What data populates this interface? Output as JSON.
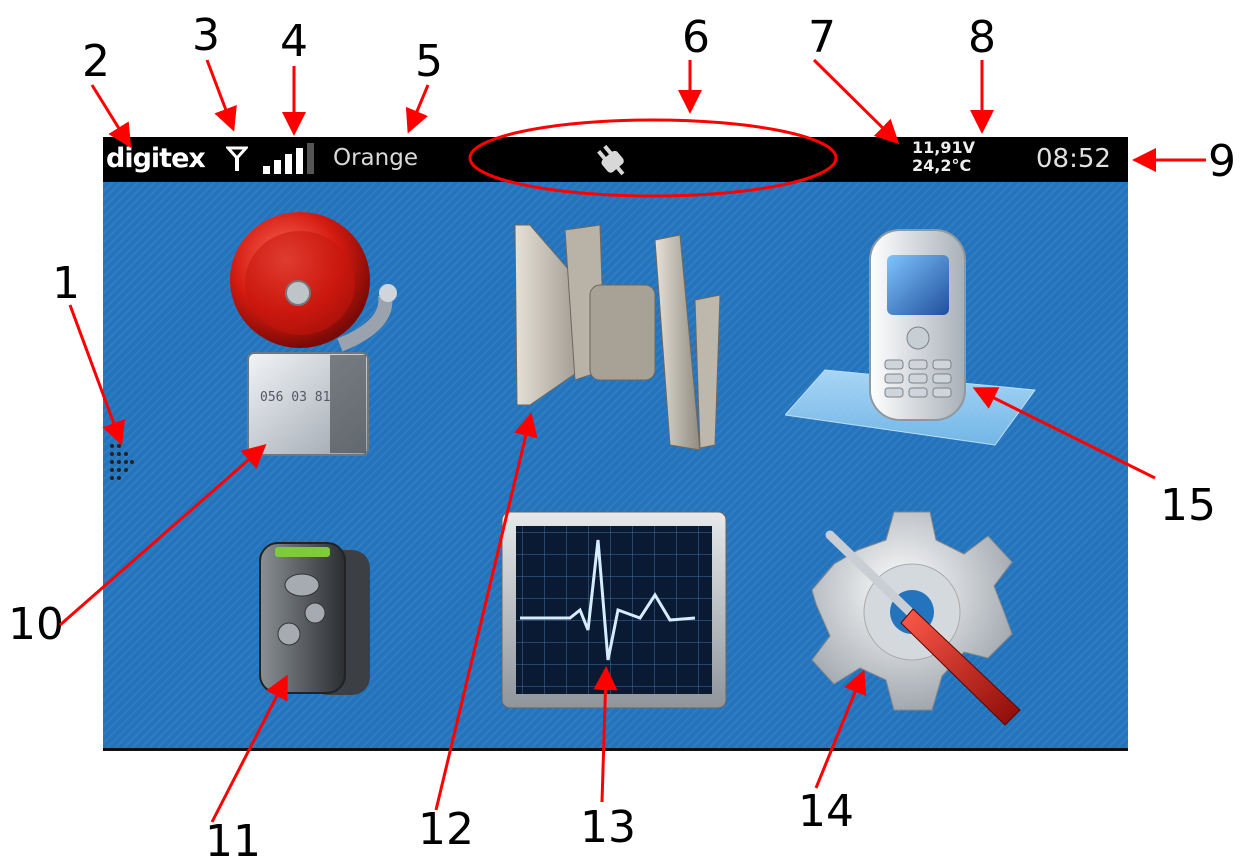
{
  "callouts": {
    "n1": "1",
    "n2": "2",
    "n3": "3",
    "n4": "4",
    "n5": "5",
    "n6": "6",
    "n7": "7",
    "n8": "8",
    "n9": "9",
    "n10": "10",
    "n11": "11",
    "n12": "12",
    "n13": "13",
    "n14": "14",
    "n15": "15"
  },
  "status_bar": {
    "logo": "digitex",
    "antenna_icon": "antenna-icon",
    "signal_icon": "signal-strength-icon",
    "signal_level": 0.8,
    "carrier": "Orange",
    "power_icon": "power-plug-icon",
    "voltage": "11,91V",
    "temperature": "24,2°C",
    "time": "08:52"
  },
  "screen": {
    "menu_icons": [
      "alarm-bell-icon",
      "siren-horn-icon",
      "mobile-phone-icon",
      "pager-icon",
      "heart-monitor-icon",
      "settings-gear-tools-icon"
    ],
    "bell_plate_text": "056 03 81",
    "page_indicator_icon": "page-dots-icon"
  },
  "colors": {
    "screen_bg": "#2374bd",
    "status_bg": "#000000",
    "callout_red": "#ff0000"
  }
}
